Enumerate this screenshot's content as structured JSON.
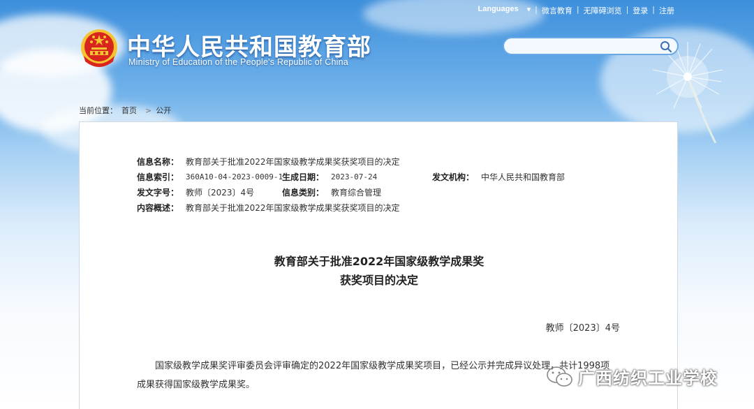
{
  "top_nav": {
    "languages": "Languages",
    "links": [
      "微言教育",
      "无障碍浏览",
      "登录",
      "注册"
    ]
  },
  "header": {
    "title": "中华人民共和国教育部",
    "subtitle": "Ministry of Education of the People's Republic of China",
    "search_placeholder": ""
  },
  "breadcrumb": {
    "prefix": "当前位置：",
    "items": [
      "首页",
      "公开"
    ]
  },
  "meta": {
    "name_label": "信息名称：",
    "name_value": "教育部关于批准2022年国家级教学成果奖获奖项目的决定",
    "index_label": "信息索引：",
    "index_value": "360A10-04-2023-0009-1",
    "date_label": "生成日期：",
    "date_value": "2023-07-24",
    "issuer_label": "发文机构：",
    "issuer_value": "中华人民共和国教育部",
    "docno_label": "发文字号：",
    "docno_value": "教师〔2023〕4号",
    "category_label": "信息类别：",
    "category_value": "教育综合管理",
    "summary_label": "内容概述：",
    "summary_value": "教育部关于批准2022年国家级教学成果奖获奖项目的决定"
  },
  "document": {
    "title_line1": "教育部关于批准2022年国家级教学成果奖",
    "title_line2": "获奖项目的决定",
    "doc_number": "教师〔2023〕4号",
    "paragraph": "国家级教学成果奖评审委员会评审确定的2022年国家级教学成果奖项目，已经公示并完成异议处理，共计1998项成果获得国家级教学成果奖。"
  },
  "watermark": {
    "text": "广西纺织工业学校"
  },
  "colors": {
    "sky_top": "#3d8fdc",
    "emblem_red": "#d8251d",
    "emblem_gold": "#f4c531"
  }
}
